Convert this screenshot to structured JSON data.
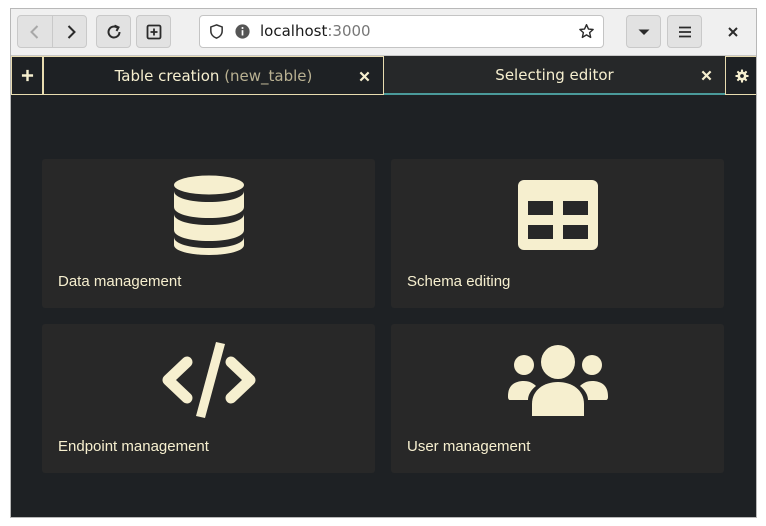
{
  "browser": {
    "url_host": "localhost",
    "url_port": ":3000"
  },
  "tabs": [
    {
      "title": "Table creation",
      "subtitle": "(new_table)"
    },
    {
      "title": "Selecting editor",
      "subtitle": ""
    }
  ],
  "cards": [
    {
      "label": "Data management",
      "icon": "database-icon"
    },
    {
      "label": "Schema editing",
      "icon": "table-icon"
    },
    {
      "label": "Endpoint management",
      "icon": "code-icon"
    },
    {
      "label": "User management",
      "icon": "users-icon"
    }
  ],
  "colors": {
    "background": "#1e2124",
    "card": "#282828",
    "accent": "#f6efcf",
    "tab_border": "#e8dcb0",
    "active_tab_underline": "#4a9a9a"
  }
}
